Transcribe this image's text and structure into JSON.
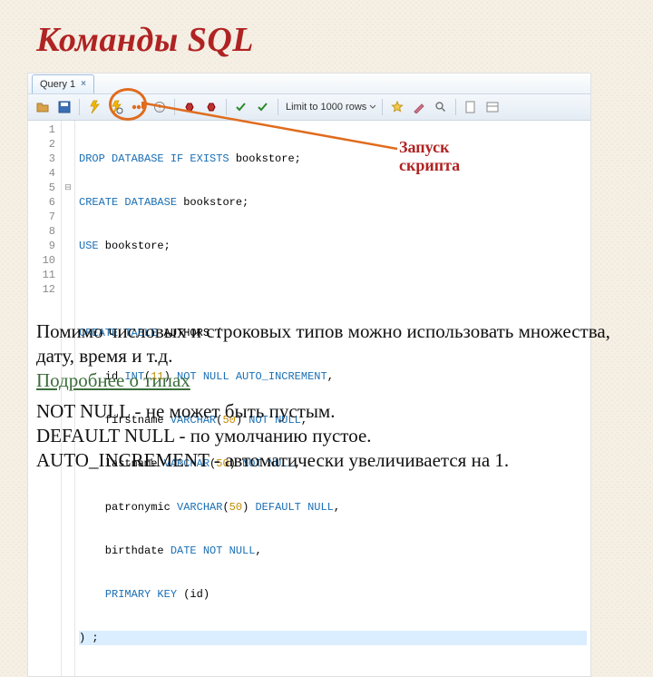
{
  "title": "Команды SQL",
  "callout": {
    "line1": "Запуск",
    "line2": "скрипта"
  },
  "tab": {
    "label": "Query 1",
    "close": "×"
  },
  "toolbar": {
    "open": "open-icon",
    "save": "save-icon",
    "run": "run-icon",
    "runSel": "run-selected-icon",
    "stop": "stop-icon",
    "explain": "explain-icon",
    "commit": "commit-icon",
    "rollback": "rollback-icon",
    "check1": "check-icon",
    "check2": "check-icon",
    "limit": "Limit to 1000 rows",
    "star": "star-icon",
    "brush": "format-icon",
    "search": "search-icon",
    "page": "page-icon",
    "panel": "panel-icon"
  },
  "code": {
    "nums": [
      "1",
      "2",
      "3",
      "4",
      "5",
      "6",
      "7",
      "8",
      "9",
      "10",
      "11",
      "12"
    ],
    "l1": {
      "a": "DROP DATABASE IF EXISTS",
      "b": " bookstore;"
    },
    "l2": {
      "a": "CREATE DATABASE",
      "b": " bookstore;"
    },
    "l3": {
      "a": "USE",
      "b": " bookstore;"
    },
    "l5": {
      "a": "CREATE TABLE",
      "b": " AUTHORS ("
    },
    "l6": {
      "a": "    id ",
      "b": "INT",
      "c": "(",
      "d": "11",
      "e": ") ",
      "f": "NOT NULL AUTO_INCREMENT",
      "g": ","
    },
    "l7": {
      "a": "    firstname ",
      "b": "VARCHAR",
      "c": "(",
      "d": "50",
      "e": ") ",
      "f": "NOT NULL",
      "g": ","
    },
    "l8": {
      "a": "    lastname ",
      "b": "VARCHAR",
      "c": "(",
      "d": "50",
      "e": ") ",
      "f": "NOT NULL",
      "g": ","
    },
    "l9": {
      "a": "    patronymic ",
      "b": "VARCHAR",
      "c": "(",
      "d": "50",
      "e": ") ",
      "f": "DEFAULT NULL",
      "g": ","
    },
    "l10": {
      "a": "    birthdate ",
      "b": "DATE NOT NULL",
      "c": ","
    },
    "l11": {
      "a": "    ",
      "b": "PRIMARY KEY",
      "c": " (id)"
    },
    "l12": ") ;"
  },
  "para1": {
    "text": "Помимо числовых и строковых типов можно использовать множества, дату, время и т.д.",
    "link": "Подробнее о типах"
  },
  "para2": {
    "l1": "NOT NULL - не может быть пустым.",
    "l2": "DEFAULT NULL - по умолчанию пустое.",
    "l3": "AUTO_INCREMENT - автоматически увеличивается на 1."
  }
}
